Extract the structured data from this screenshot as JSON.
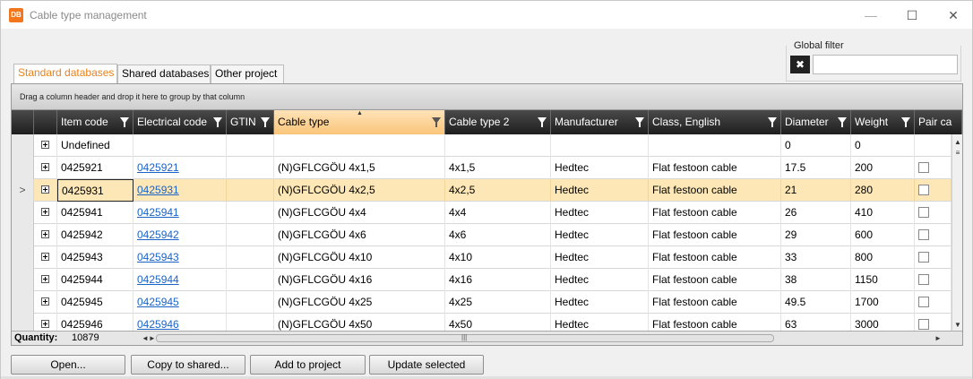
{
  "window": {
    "icon_text": "DB",
    "title": "Cable type management",
    "minimize_glyph": "—",
    "maximize_glyph": "☐",
    "close_glyph": "✕"
  },
  "global_filter": {
    "label": "Global filter",
    "value": "",
    "clear_icon": "eraser-icon"
  },
  "tabs": [
    {
      "label": "Standard databases",
      "active": true
    },
    {
      "label": "Shared databases",
      "active": false
    },
    {
      "label": "Other project",
      "active": false
    }
  ],
  "grid": {
    "group_hint": "Drag a column header and drop it here to group by that column",
    "sorted_column": "Cable type",
    "columns": [
      "Item code",
      "Electrical code",
      "GTIN",
      "Cable type",
      "Cable type 2",
      "Manufacturer",
      "Class, English",
      "Diameter",
      "Weight",
      "Pair ca"
    ],
    "rows": [
      {
        "indicator": "",
        "item_code": "Undefined",
        "electrical_code": "",
        "gtin": "",
        "cable_type": "",
        "cable_type_2": "",
        "manufacturer": "",
        "class_english": "",
        "diameter": "0",
        "weight": "0",
        "pair_check": false
      },
      {
        "indicator": "",
        "item_code": "0425921",
        "electrical_code": "0425921",
        "gtin": "",
        "cable_type": "(N)GFLCGÖU 4x1,5",
        "cable_type_2": "4x1,5",
        "manufacturer": "Hedtec",
        "class_english": "Flat festoon cable",
        "diameter": "17.5",
        "weight": "200",
        "pair_check": true
      },
      {
        "indicator": ">",
        "item_code": "0425931",
        "electrical_code": "0425931",
        "gtin": "",
        "cable_type": "(N)GFLCGÖU 4x2,5",
        "cable_type_2": "4x2,5",
        "manufacturer": "Hedtec",
        "class_english": "Flat festoon cable",
        "diameter": "21",
        "weight": "280",
        "pair_check": true
      },
      {
        "indicator": "",
        "item_code": "0425941",
        "electrical_code": "0425941",
        "gtin": "",
        "cable_type": "(N)GFLCGÖU 4x4",
        "cable_type_2": "4x4",
        "manufacturer": "Hedtec",
        "class_english": "Flat festoon cable",
        "diameter": "26",
        "weight": "410",
        "pair_check": true
      },
      {
        "indicator": "",
        "item_code": "0425942",
        "electrical_code": "0425942",
        "gtin": "",
        "cable_type": "(N)GFLCGÖU 4x6",
        "cable_type_2": "4x6",
        "manufacturer": "Hedtec",
        "class_english": "Flat festoon cable",
        "diameter": "29",
        "weight": "600",
        "pair_check": true
      },
      {
        "indicator": "",
        "item_code": "0425943",
        "electrical_code": "0425943",
        "gtin": "",
        "cable_type": "(N)GFLCGÖU 4x10",
        "cable_type_2": "4x10",
        "manufacturer": "Hedtec",
        "class_english": "Flat festoon cable",
        "diameter": "33",
        "weight": "800",
        "pair_check": true
      },
      {
        "indicator": "",
        "item_code": "0425944",
        "electrical_code": "0425944",
        "gtin": "",
        "cable_type": "(N)GFLCGÖU 4x16",
        "cable_type_2": "4x16",
        "manufacturer": "Hedtec",
        "class_english": "Flat festoon cable",
        "diameter": "38",
        "weight": "1150",
        "pair_check": true
      },
      {
        "indicator": "",
        "item_code": "0425945",
        "electrical_code": "0425945",
        "gtin": "",
        "cable_type": "(N)GFLCGÖU 4x25",
        "cable_type_2": "4x25",
        "manufacturer": "Hedtec",
        "class_english": "Flat festoon cable",
        "diameter": "49.5",
        "weight": "1700",
        "pair_check": true
      },
      {
        "indicator": "",
        "item_code": "0425946",
        "electrical_code": "0425946",
        "gtin": "",
        "cable_type": "(N)GFLCGÖU 4x50",
        "cable_type_2": "4x50",
        "manufacturer": "Hedtec",
        "class_english": "Flat festoon cable",
        "diameter": "63",
        "weight": "3000",
        "pair_check": true
      }
    ],
    "quantity_label": "Quantity:",
    "quantity_value": "10879"
  },
  "buttons": {
    "open": "Open...",
    "copy_to_shared": "Copy to shared...",
    "add_to_project": "Add to project",
    "update_selected": "Update selected"
  },
  "colors": {
    "accent": "#e8821a",
    "selected_row": "#fde7b6",
    "header_dark": "#1e1e1e",
    "link": "#1a63c7"
  }
}
